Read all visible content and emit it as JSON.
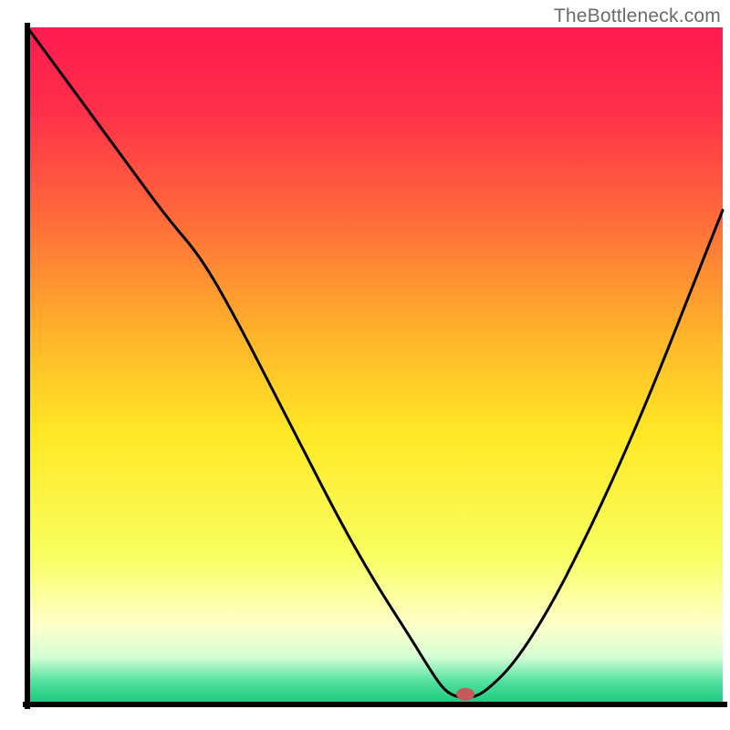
{
  "watermark": "TheBottleneck.com",
  "chart_data": {
    "type": "line",
    "title": "",
    "xlabel": "",
    "ylabel": "",
    "xlim": [
      0,
      100
    ],
    "ylim": [
      0,
      100
    ],
    "background_gradient": {
      "stops": [
        {
          "offset": 0.0,
          "color": "#ff1a4f"
        },
        {
          "offset": 0.12,
          "color": "#ff2e4a"
        },
        {
          "offset": 0.28,
          "color": "#ff6a3a"
        },
        {
          "offset": 0.45,
          "color": "#ffb22a"
        },
        {
          "offset": 0.6,
          "color": "#ffe825"
        },
        {
          "offset": 0.78,
          "color": "#f8ff60"
        },
        {
          "offset": 0.88,
          "color": "#ffffc8"
        },
        {
          "offset": 0.93,
          "color": "#d4ffd4"
        },
        {
          "offset": 0.965,
          "color": "#55e2a0"
        },
        {
          "offset": 1.0,
          "color": "#14c77a"
        }
      ]
    },
    "series": [
      {
        "name": "bottleneck-curve",
        "x": [
          0,
          5,
          10,
          15,
          20,
          25,
          30,
          35,
          40,
          45,
          50,
          55,
          58,
          60,
          62,
          64,
          66,
          70,
          75,
          80,
          85,
          90,
          95,
          100
        ],
        "y": [
          100,
          93,
          86,
          79,
          72,
          66,
          57,
          47,
          37,
          27,
          18,
          10,
          5,
          2,
          1,
          1,
          2,
          6,
          14,
          24,
          35,
          47,
          60,
          73
        ]
      }
    ],
    "marker": {
      "name": "optimal-point",
      "x": 63,
      "y": 1.5,
      "color": "#c65a5a",
      "rx": 10,
      "ry": 7
    },
    "axis_color": "#000000",
    "curve_color": "#000000",
    "curve_width": 3
  }
}
